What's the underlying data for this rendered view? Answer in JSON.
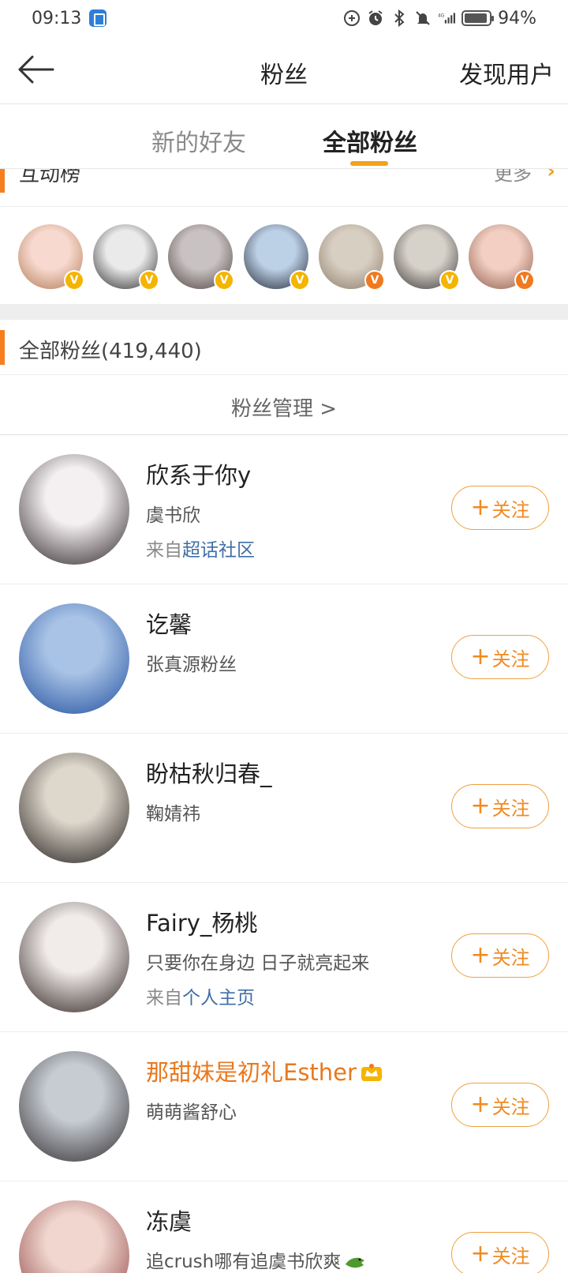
{
  "status_bar": {
    "time": "09:13",
    "network": "4G",
    "battery_percent": "94%",
    "battery_level": 0.94
  },
  "nav": {
    "title": "粉丝",
    "discover_label": "发现用户"
  },
  "tabs": [
    {
      "label": "新的好友",
      "active": false
    },
    {
      "label": "全部粉丝",
      "active": true
    }
  ],
  "interaction_rank": {
    "title": "互动榜",
    "more_label": "更多",
    "avatars": [
      {
        "badge": "V",
        "badge_color": "#f5b400",
        "avatar_colors": [
          "#f7d9cf",
          "#b07a52"
        ]
      },
      {
        "badge": "V",
        "badge_color": "#f5b400",
        "avatar_colors": [
          "#eaeaea",
          "#2a2a2a"
        ]
      },
      {
        "badge": "V",
        "badge_color": "#f5b400",
        "avatar_colors": [
          "#c9c2c2",
          "#4d3f3f"
        ]
      },
      {
        "badge": "V",
        "badge_color": "#f5b400",
        "avatar_colors": [
          "#bcd0e6",
          "#1f2533"
        ]
      },
      {
        "badge": "V",
        "badge_color": "#f07a1f",
        "avatar_colors": [
          "#d8cfc3",
          "#8a7a66"
        ]
      },
      {
        "badge": "V",
        "badge_color": "#f5b400",
        "avatar_colors": [
          "#d6d1c9",
          "#3a3434"
        ]
      },
      {
        "badge": "V",
        "badge_color": "#f07a1f",
        "avatar_colors": [
          "#f2cfc2",
          "#8c5a4a"
        ]
      }
    ]
  },
  "all_fans": {
    "title": "全部粉丝(419,440)",
    "manage_label": "粉丝管理  >"
  },
  "follow_label": "关注",
  "fans": [
    {
      "name": "欣系于你y",
      "desc": "虞书欣",
      "source_prefix": "来自",
      "source_link": "超话社区",
      "vip": false,
      "avatar_colors": [
        "#f4f0f2",
        "#2b2224"
      ]
    },
    {
      "name": "讫馨",
      "desc": "张真源粉丝",
      "source_prefix": "",
      "source_link": "",
      "vip": false,
      "avatar_colors": [
        "#a9c3e6",
        "#1f4e9e"
      ]
    },
    {
      "name": "盼枯秋归春_",
      "desc": "鞠婧祎",
      "source_prefix": "",
      "source_link": "",
      "vip": false,
      "avatar_colors": [
        "#ded7cc",
        "#1e1a18"
      ]
    },
    {
      "name": "Fairy_杨桃",
      "desc": "只要你在身边 日子就亮起来",
      "source_prefix": "来自",
      "source_link": "个人主页",
      "vip": false,
      "avatar_colors": [
        "#f1ecea",
        "#2b1f1d"
      ]
    },
    {
      "name": "那甜妹是初礼Esther",
      "desc": "萌萌酱舒心",
      "source_prefix": "",
      "source_link": "",
      "vip": true,
      "avatar_colors": [
        "#c7ccd3",
        "#2e2a2c"
      ]
    },
    {
      "name": "冻虞",
      "desc": "追crush哪有追虞书欣爽",
      "source_prefix": "",
      "source_link": "",
      "vip": false,
      "avatar_colors": [
        "#f0d6cf",
        "#8a3a3a"
      ]
    }
  ]
}
